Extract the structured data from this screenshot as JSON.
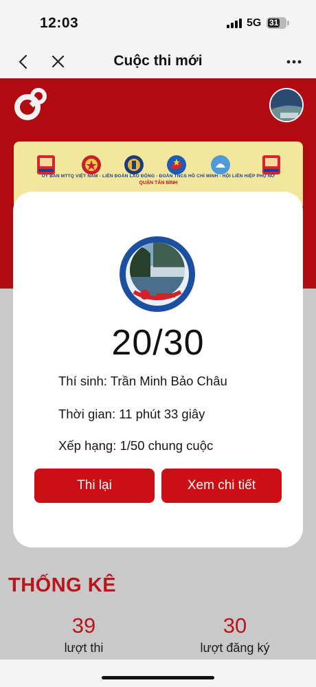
{
  "status_bar": {
    "time": "12:03",
    "network": "5G",
    "battery": "31"
  },
  "nav": {
    "title": "Cuộc thi mới"
  },
  "banner": {
    "line1": "ỦY BAN MTTQ VIỆT NAM - LIÊN ĐOÀN LAO ĐỘNG - ĐOÀN TNCS HỒ CHÍ MINH - HỘI LIÊN HIỆP PHỤ NỮ",
    "line2": "QUẬN TÂN BÌNH"
  },
  "result": {
    "score": "20/30",
    "contestant": "Thí sinh: Trần Minh Bảo Châu",
    "time": "Thời gian: 11 phút 33 giây",
    "rank": "Xếp hạng: 1/50 chung cuộc",
    "retry_label": "Thi lại",
    "detail_label": "Xem chi tiết"
  },
  "stats": {
    "title": "THỐNG KÊ",
    "items": [
      {
        "value": "39",
        "label": "lượt thi"
      },
      {
        "value": "30",
        "label": "lượt đăng ký"
      }
    ]
  },
  "colors": {
    "brand_red": "#b10a10",
    "button_red": "#cc0f15",
    "stat_red": "#b8161c",
    "banner_yellow": "#f3e69d"
  },
  "icons": [
    "back-chevron-icon",
    "close-icon",
    "more-icon",
    "app-logo-icon",
    "avatar",
    "contest-logo"
  ]
}
